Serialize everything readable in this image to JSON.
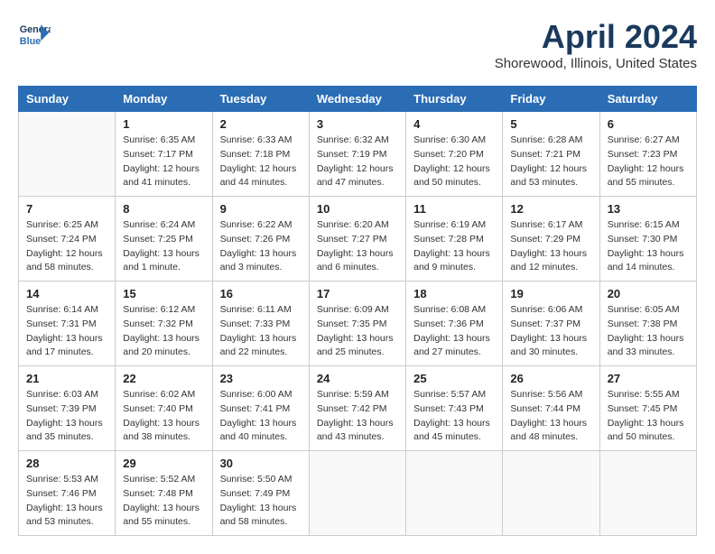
{
  "header": {
    "logo_line1": "General",
    "logo_line2": "Blue",
    "month": "April 2024",
    "location": "Shorewood, Illinois, United States"
  },
  "weekdays": [
    "Sunday",
    "Monday",
    "Tuesday",
    "Wednesday",
    "Thursday",
    "Friday",
    "Saturday"
  ],
  "weeks": [
    [
      {
        "day": "",
        "info": ""
      },
      {
        "day": "1",
        "info": "Sunrise: 6:35 AM\nSunset: 7:17 PM\nDaylight: 12 hours\nand 41 minutes."
      },
      {
        "day": "2",
        "info": "Sunrise: 6:33 AM\nSunset: 7:18 PM\nDaylight: 12 hours\nand 44 minutes."
      },
      {
        "day": "3",
        "info": "Sunrise: 6:32 AM\nSunset: 7:19 PM\nDaylight: 12 hours\nand 47 minutes."
      },
      {
        "day": "4",
        "info": "Sunrise: 6:30 AM\nSunset: 7:20 PM\nDaylight: 12 hours\nand 50 minutes."
      },
      {
        "day": "5",
        "info": "Sunrise: 6:28 AM\nSunset: 7:21 PM\nDaylight: 12 hours\nand 53 minutes."
      },
      {
        "day": "6",
        "info": "Sunrise: 6:27 AM\nSunset: 7:23 PM\nDaylight: 12 hours\nand 55 minutes."
      }
    ],
    [
      {
        "day": "7",
        "info": "Sunrise: 6:25 AM\nSunset: 7:24 PM\nDaylight: 12 hours\nand 58 minutes."
      },
      {
        "day": "8",
        "info": "Sunrise: 6:24 AM\nSunset: 7:25 PM\nDaylight: 13 hours\nand 1 minute."
      },
      {
        "day": "9",
        "info": "Sunrise: 6:22 AM\nSunset: 7:26 PM\nDaylight: 13 hours\nand 3 minutes."
      },
      {
        "day": "10",
        "info": "Sunrise: 6:20 AM\nSunset: 7:27 PM\nDaylight: 13 hours\nand 6 minutes."
      },
      {
        "day": "11",
        "info": "Sunrise: 6:19 AM\nSunset: 7:28 PM\nDaylight: 13 hours\nand 9 minutes."
      },
      {
        "day": "12",
        "info": "Sunrise: 6:17 AM\nSunset: 7:29 PM\nDaylight: 13 hours\nand 12 minutes."
      },
      {
        "day": "13",
        "info": "Sunrise: 6:15 AM\nSunset: 7:30 PM\nDaylight: 13 hours\nand 14 minutes."
      }
    ],
    [
      {
        "day": "14",
        "info": "Sunrise: 6:14 AM\nSunset: 7:31 PM\nDaylight: 13 hours\nand 17 minutes."
      },
      {
        "day": "15",
        "info": "Sunrise: 6:12 AM\nSunset: 7:32 PM\nDaylight: 13 hours\nand 20 minutes."
      },
      {
        "day": "16",
        "info": "Sunrise: 6:11 AM\nSunset: 7:33 PM\nDaylight: 13 hours\nand 22 minutes."
      },
      {
        "day": "17",
        "info": "Sunrise: 6:09 AM\nSunset: 7:35 PM\nDaylight: 13 hours\nand 25 minutes."
      },
      {
        "day": "18",
        "info": "Sunrise: 6:08 AM\nSunset: 7:36 PM\nDaylight: 13 hours\nand 27 minutes."
      },
      {
        "day": "19",
        "info": "Sunrise: 6:06 AM\nSunset: 7:37 PM\nDaylight: 13 hours\nand 30 minutes."
      },
      {
        "day": "20",
        "info": "Sunrise: 6:05 AM\nSunset: 7:38 PM\nDaylight: 13 hours\nand 33 minutes."
      }
    ],
    [
      {
        "day": "21",
        "info": "Sunrise: 6:03 AM\nSunset: 7:39 PM\nDaylight: 13 hours\nand 35 minutes."
      },
      {
        "day": "22",
        "info": "Sunrise: 6:02 AM\nSunset: 7:40 PM\nDaylight: 13 hours\nand 38 minutes."
      },
      {
        "day": "23",
        "info": "Sunrise: 6:00 AM\nSunset: 7:41 PM\nDaylight: 13 hours\nand 40 minutes."
      },
      {
        "day": "24",
        "info": "Sunrise: 5:59 AM\nSunset: 7:42 PM\nDaylight: 13 hours\nand 43 minutes."
      },
      {
        "day": "25",
        "info": "Sunrise: 5:57 AM\nSunset: 7:43 PM\nDaylight: 13 hours\nand 45 minutes."
      },
      {
        "day": "26",
        "info": "Sunrise: 5:56 AM\nSunset: 7:44 PM\nDaylight: 13 hours\nand 48 minutes."
      },
      {
        "day": "27",
        "info": "Sunrise: 5:55 AM\nSunset: 7:45 PM\nDaylight: 13 hours\nand 50 minutes."
      }
    ],
    [
      {
        "day": "28",
        "info": "Sunrise: 5:53 AM\nSunset: 7:46 PM\nDaylight: 13 hours\nand 53 minutes."
      },
      {
        "day": "29",
        "info": "Sunrise: 5:52 AM\nSunset: 7:48 PM\nDaylight: 13 hours\nand 55 minutes."
      },
      {
        "day": "30",
        "info": "Sunrise: 5:50 AM\nSunset: 7:49 PM\nDaylight: 13 hours\nand 58 minutes."
      },
      {
        "day": "",
        "info": ""
      },
      {
        "day": "",
        "info": ""
      },
      {
        "day": "",
        "info": ""
      },
      {
        "day": "",
        "info": ""
      }
    ]
  ]
}
